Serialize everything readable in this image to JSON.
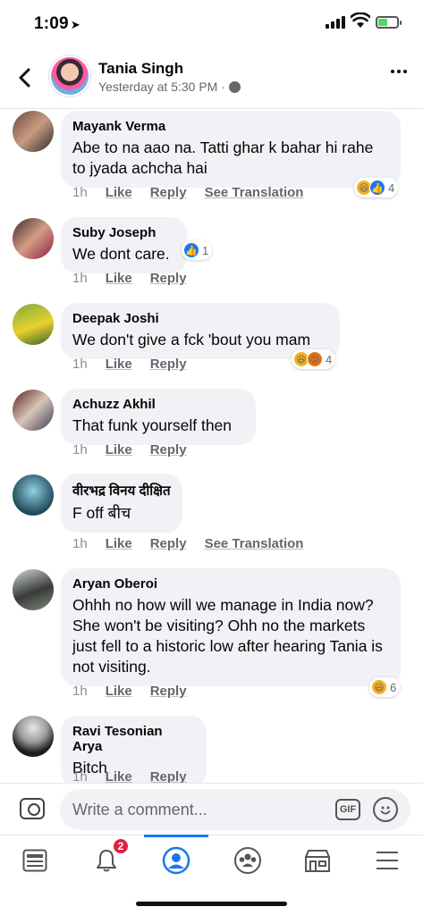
{
  "status": {
    "time": "1:09",
    "location_icon": "location-arrow-icon"
  },
  "header": {
    "name": "Tania Singh",
    "timestamp": "Yesterday at 5:30 PM",
    "privacy_icon": "globe-icon"
  },
  "action_labels": {
    "like": "Like",
    "reply": "Reply",
    "see_translation": "See Translation"
  },
  "comments": [
    {
      "name": "Mayank Verma",
      "text": "Abe to na aao na. Tatti ghar k bahar hi rahe to jyada achcha hai",
      "time": "1h",
      "translation": true,
      "reactions": [
        "haha",
        "like"
      ],
      "reaction_count": "4"
    },
    {
      "name": "Suby Joseph",
      "text": "We dont care.",
      "time": "1h",
      "translation": false,
      "reactions": [
        "like"
      ],
      "reaction_count": "1"
    },
    {
      "name": "Deepak Joshi",
      "text": "We don't give a fck 'bout you mam",
      "time": "1h",
      "translation": false,
      "reactions": [
        "haha",
        "angry"
      ],
      "reaction_count": "4"
    },
    {
      "name": "Achuzz Akhil",
      "text": "That funk yourself then",
      "time": "1h",
      "translation": false,
      "reactions": [],
      "reaction_count": ""
    },
    {
      "name": "वीरभद्र विनय दीक्षित",
      "text": "F off बीच",
      "time": "1h",
      "translation": true,
      "reactions": [],
      "reaction_count": ""
    },
    {
      "name": "Aryan Oberoi",
      "text": "Ohhh no how will we manage in India now? She won't be visiting? Ohh no the markets just fell to a historic low after hearing Tania is not visiting.",
      "time": "1h",
      "translation": false,
      "reactions": [
        "haha"
      ],
      "reaction_count": "6"
    },
    {
      "name": "Ravi Tesonian Arya",
      "text": "Bitch",
      "time": "1h",
      "translation": false,
      "reactions": [],
      "reaction_count": ""
    }
  ],
  "composer": {
    "placeholder": "Write a comment...",
    "gif_label": "GIF"
  },
  "tabbar": {
    "notifications_badge": "2",
    "active_tab": "profile"
  },
  "colors": {
    "accent": "#1877f2",
    "bubble": "#f0f2f5",
    "badge": "#e41e3f"
  }
}
